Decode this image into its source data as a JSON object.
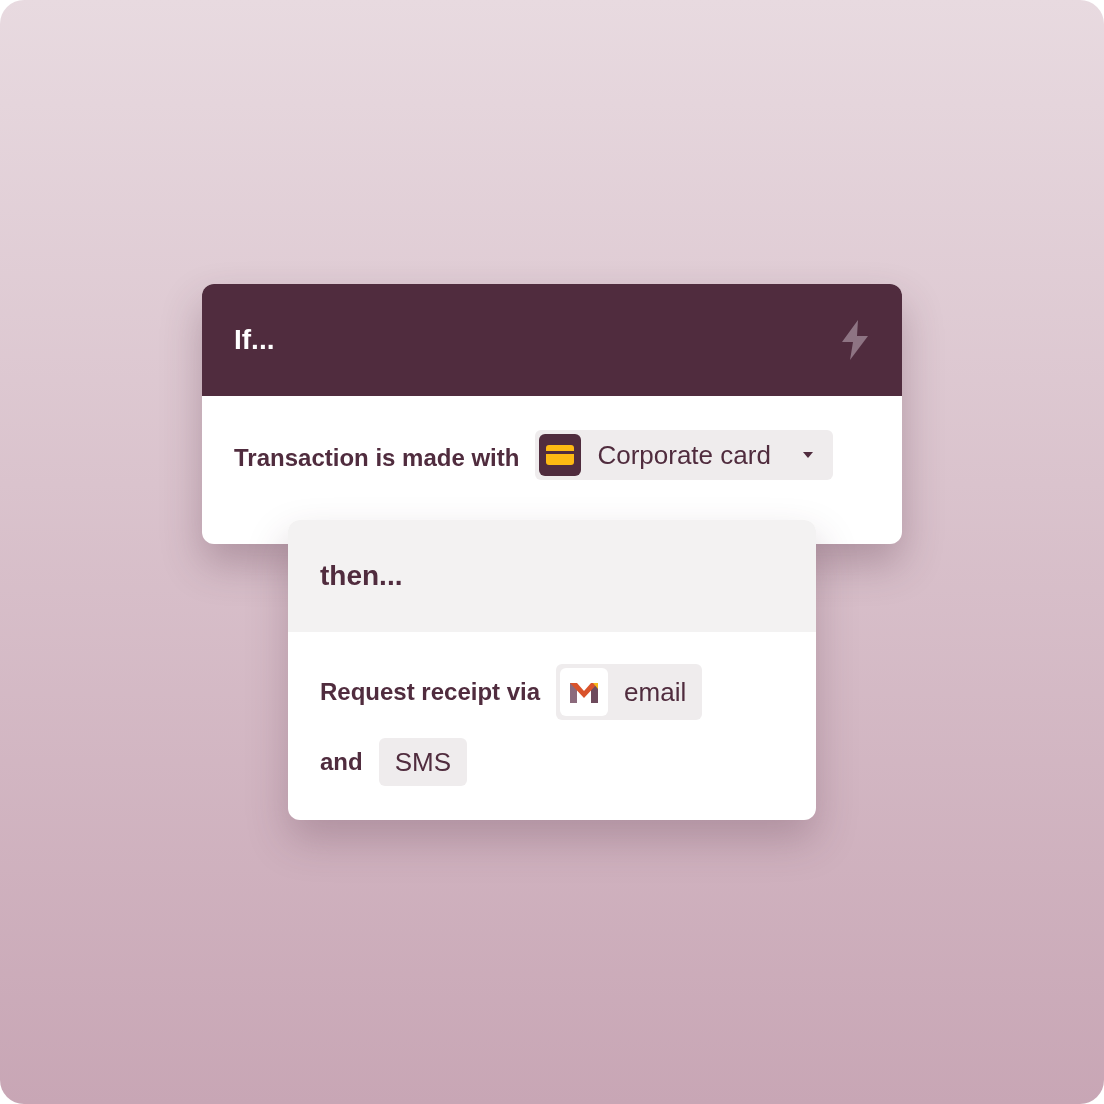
{
  "trigger": {
    "title": "If...",
    "condition": {
      "text": "Transaction is made with",
      "chip": {
        "kind": "card-select",
        "label": "Corporate card"
      }
    }
  },
  "action": {
    "title": "then...",
    "rows": [
      {
        "text": "Request receipt via",
        "chip": {
          "kind": "mail",
          "label": "email"
        }
      },
      {
        "text": "and",
        "chip": {
          "kind": "plain",
          "label": "SMS"
        }
      }
    ]
  }
}
